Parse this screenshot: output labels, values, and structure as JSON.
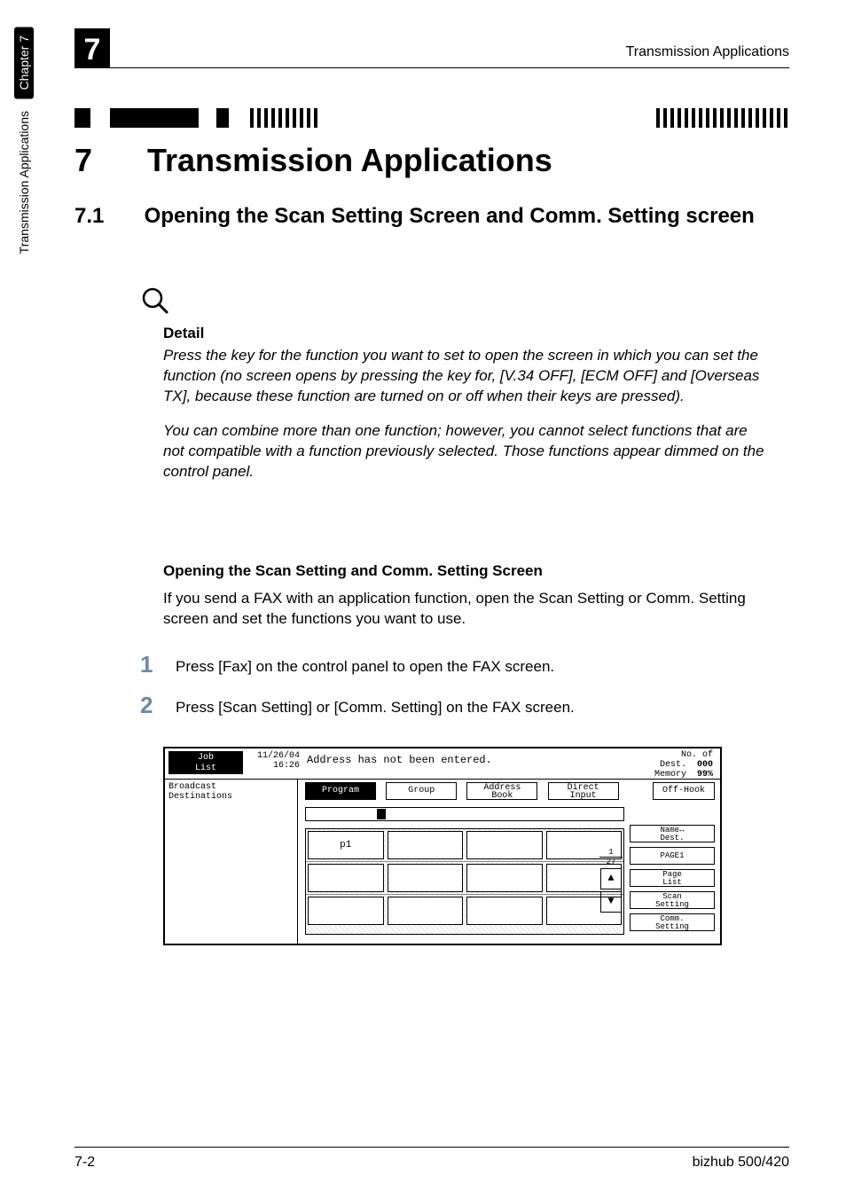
{
  "header": {
    "chapter_digit": "7",
    "running_title": "Transmission Applications"
  },
  "side_tab": {
    "chapter_label": "Chapter 7",
    "section_label": "Transmission Applications"
  },
  "h1": {
    "num": "7",
    "text": "Transmission Applications"
  },
  "h2": {
    "num": "7.1",
    "text": "Opening the Scan Setting Screen and Comm. Setting screen"
  },
  "detail": {
    "heading": "Detail",
    "para1": "Press the key for the function you want to set to open the screen in which you can set the function (no screen opens by pressing the key for, [V.34 OFF], [ECM OFF] and [Overseas TX], because these function are turned on or off when their keys are pressed).",
    "para2": "You can combine more than one function; however, you cannot select functions that are not compatible with a function previously selected. Those functions appear dimmed on the control panel."
  },
  "h3": "Opening the Scan Setting and Comm. Setting Screen",
  "body_para": "If you send a FAX with an application function, open the Scan Setting or Comm. Setting screen and set the functions you want to use.",
  "steps": [
    {
      "num": "1",
      "text": "Press [Fax] on the control panel to open the FAX screen."
    },
    {
      "num": "2",
      "text": "Press [Scan Setting] or [Comm. Setting] on the FAX screen."
    }
  ],
  "lcd": {
    "joblist": "Job\nList",
    "date": "11/26/04",
    "time": "16:26",
    "status": "Address has not been entered.",
    "noof_label": "No. of\nDest.",
    "noof_val": "000",
    "memory_label": "Memory",
    "memory_val": "99%",
    "left_label1": "Broadcast",
    "left_label2": "Destinations",
    "tabs": {
      "program": "Program",
      "group": "Group",
      "address_book": "Address\nBook",
      "direct_input": "Direct\nInput"
    },
    "offhook": "Off-Hook",
    "grid_first_cell": "p1",
    "pager_current": "1",
    "pager_total": "27",
    "right_buttons": {
      "name_dest": "Name↔\nDest.",
      "page1": "PAGE1",
      "page_list": "Page\nList",
      "scan_setting": "Scan\nSetting",
      "comm_setting": "Comm.\nSetting"
    },
    "arrow_up": "▲",
    "arrow_down": "▼"
  },
  "footer": {
    "left": "7-2",
    "right": "bizhub 500/420"
  }
}
